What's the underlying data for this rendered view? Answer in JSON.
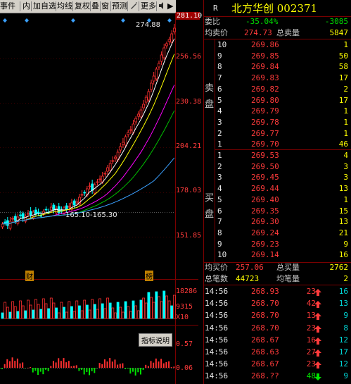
{
  "toolbar": {
    "items": [
      "事件",
      "内",
      "加自选",
      "均线",
      "复权",
      "叠",
      "窗",
      "预测",
      "",
      "更多"
    ],
    "arrow_right": "▶"
  },
  "chart": {
    "price_labels": [
      "281.10",
      "256.56",
      "230.38",
      "204.21",
      "178.03",
      "151.85"
    ],
    "top_marker": "274.88",
    "low_marker": "165.10-165.30",
    "marker_cai": "财",
    "marker_bang": "榜",
    "volume_labels": [
      "18286",
      "9315",
      "X10"
    ],
    "indicator_button": "指标说明",
    "indicator_labels": [
      "0.57",
      "0.06"
    ]
  },
  "quote": {
    "header_letter": "R",
    "title": "北方华创 002371",
    "weibi_label": "委比",
    "weibi_pct": "-35.04%",
    "weibi_diff": "-3085",
    "avg_sell_label": "均卖价",
    "avg_sell_price": "274.73",
    "total_sell_label": "总卖量",
    "total_sell_qty": "5847",
    "sell_side_label": [
      "卖",
      "盘"
    ],
    "sell": [
      {
        "lvl": "10",
        "price": "269.86",
        "qty": "1"
      },
      {
        "lvl": "9",
        "price": "269.85",
        "qty": "50"
      },
      {
        "lvl": "8",
        "price": "269.84",
        "qty": "58"
      },
      {
        "lvl": "7",
        "price": "269.83",
        "qty": "17"
      },
      {
        "lvl": "6",
        "price": "269.82",
        "qty": "2"
      },
      {
        "lvl": "5",
        "price": "269.80",
        "qty": "17"
      },
      {
        "lvl": "4",
        "price": "269.79",
        "qty": "1"
      },
      {
        "lvl": "3",
        "price": "269.78",
        "qty": "1"
      },
      {
        "lvl": "2",
        "price": "269.77",
        "qty": "1"
      },
      {
        "lvl": "1",
        "price": "269.70",
        "qty": "46"
      }
    ],
    "buy_side_label": [
      "买",
      "盘"
    ],
    "buy": [
      {
        "lvl": "1",
        "price": "269.53",
        "qty": "4"
      },
      {
        "lvl": "2",
        "price": "269.50",
        "qty": "3"
      },
      {
        "lvl": "3",
        "price": "269.45",
        "qty": "3"
      },
      {
        "lvl": "4",
        "price": "269.44",
        "qty": "13"
      },
      {
        "lvl": "5",
        "price": "269.40",
        "qty": "1"
      },
      {
        "lvl": "6",
        "price": "269.35",
        "qty": "15"
      },
      {
        "lvl": "7",
        "price": "269.30",
        "qty": "13"
      },
      {
        "lvl": "8",
        "price": "269.24",
        "qty": "21"
      },
      {
        "lvl": "9",
        "price": "269.23",
        "qty": "9"
      },
      {
        "lvl": "10",
        "price": "269.14",
        "qty": "16"
      }
    ],
    "avg_buy_label": "均买价",
    "avg_buy_price": "257.06",
    "total_buy_label": "总买量",
    "total_buy_qty": "2762",
    "total_trades_label": "总笔数",
    "total_trades": "44723",
    "avg_trade_label": "均笔量",
    "avg_trade": "2",
    "ticks": [
      {
        "time": "14:56",
        "price": "268.93",
        "vol": "23",
        "dir": "up",
        "n": "16"
      },
      {
        "time": "14:56",
        "price": "268.70",
        "vol": "42",
        "dir": "up",
        "n": "13"
      },
      {
        "time": "14:56",
        "price": "268.70",
        "vol": "13",
        "dir": "up",
        "n": "9"
      },
      {
        "time": "14:56",
        "price": "268.70",
        "vol": "23",
        "dir": "up",
        "n": "8"
      },
      {
        "time": "14:56",
        "price": "268.67",
        "vol": "16",
        "dir": "up",
        "n": "12"
      },
      {
        "time": "14:56",
        "price": "268.63",
        "vol": "27",
        "dir": "up",
        "n": "17"
      },
      {
        "time": "14:56",
        "price": "268.67",
        "vol": "23",
        "dir": "up",
        "n": "12"
      },
      {
        "time": "14:56",
        "price": "268.??",
        "vol": "48",
        "dir": "down",
        "n": "9"
      }
    ]
  }
}
